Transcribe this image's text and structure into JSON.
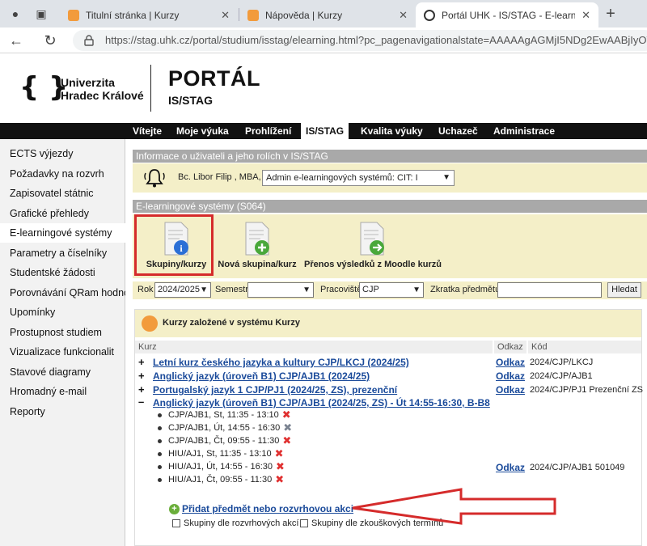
{
  "browser": {
    "tabs": [
      {
        "label": "Titulní stránka | Kurzy"
      },
      {
        "label": "Nápověda | Kurzy"
      },
      {
        "label": "Portál UHK - IS/STAG - E-learning"
      }
    ],
    "url": "https://stag.uhk.cz/portal/studium/isstag/elearning.html?pc_pagenavigationalstate=AAAAAgAGMjI5NDg2EwAABjIyOT"
  },
  "header": {
    "brace": "{ }",
    "uni_line1": "Univerzita",
    "uni_line2": "Hradec Králové",
    "portal": "PORTÁL",
    "subtitle": "IS/STAG"
  },
  "topmenu": [
    "Vítejte",
    "Moje výuka",
    "Prohlížení",
    "IS/STAG",
    "Kvalita výuky",
    "Uchazeč",
    "Administrace"
  ],
  "sidebar": [
    "ECTS výjezdy",
    "Požadavky na rozvrh",
    "Zapisovatel státnic",
    "Grafické přehledy",
    "E-learningové systémy",
    "Parametry a číselníky",
    "Studentské žádosti",
    "Porovnávání QRam hodnot",
    "Upomínky",
    "Prostupnost studiem",
    "Vizualizace funkcionalit",
    "Stavové diagramy",
    "Hromadný e-mail",
    "Reporty"
  ],
  "user_section": {
    "title": "Informace o uživateli a jeho rolích v IS/STAG",
    "name": "Bc. Libor Filip , MBA,",
    "role": "Admin e-learningových systémů: CIT: I"
  },
  "elearning": {
    "title": "E-learningové systémy (S064)",
    "tools": [
      "Skupiny/kurzy",
      "Nová skupina/kurz",
      "Přenos výsledků z Moodle kurzů"
    ]
  },
  "filter": {
    "rok_label": "Rok",
    "rok_value": "2024/2025",
    "semestr_label": "Semestr",
    "semestr_value": "",
    "pracoviste_label": "Pracoviště",
    "pracoviste_value": "CJP",
    "zkratka_label": "Zkratka předmětu",
    "search_button": "Hledat"
  },
  "courses_box": {
    "title": "Kurzy založené v systému Kurzy",
    "col_kurz": "Kurz",
    "col_odkaz": "Odkaz",
    "col_kod": "Kód",
    "rows": [
      {
        "toggle": "+",
        "name": "Letní kurz českého jazyka a kultury CJP/LKCJ (2024/25)",
        "odkaz": "Odkaz",
        "kod": "2024/CJP/LKCJ"
      },
      {
        "toggle": "+",
        "name": "Anglický jazyk (úroveň B1) CJP/AJB1 (2024/25)",
        "odkaz": "Odkaz",
        "kod": "2024/CJP/AJB1"
      },
      {
        "toggle": "+",
        "name": "Portugalský jazyk 1 CJP/PJ1 (2024/25, ZS), prezenční",
        "odkaz": "Odkaz",
        "kod": "2024/CJP/PJ1 Prezenční ZS"
      },
      {
        "toggle": "–",
        "name": "Anglický jazyk (úroveň B1) CJP/AJB1 (2024/25, ZS) - Út 14:55-16:30, B-B8",
        "odkaz": "Odkaz",
        "kod": "2024/CJP/AJB1 501049"
      }
    ],
    "schedule": [
      {
        "text": "CJP/AJB1, St, 11:35 - 13:10",
        "mark_color": "#e03030"
      },
      {
        "text": "CJP/AJB1, Út, 14:55 - 16:30",
        "mark_color": "#7a8290"
      },
      {
        "text": "CJP/AJB1, Čt, 09:55 - 11:30",
        "mark_color": "#e03030"
      },
      {
        "text": "HIU/AJ1, St, 11:35 - 13:10",
        "mark_color": "#e03030"
      },
      {
        "text": "HIU/AJ1, Út, 14:55 - 16:30",
        "mark_color": "#e03030"
      },
      {
        "text": "HIU/AJ1, Čt, 09:55 - 11:30",
        "mark_color": "#e03030"
      }
    ],
    "add_link": "Přidat předmět nebo rozvrhovou akci",
    "chk_rozvrh": "Skupiny dle rozvrhových akcí",
    "chk_zkous": "Skupiny dle zkouškových termínů"
  },
  "colors": {
    "accent_red": "#d52b2b",
    "link_blue": "#1a4a9a",
    "panel_yellow": "#f4efc8"
  }
}
